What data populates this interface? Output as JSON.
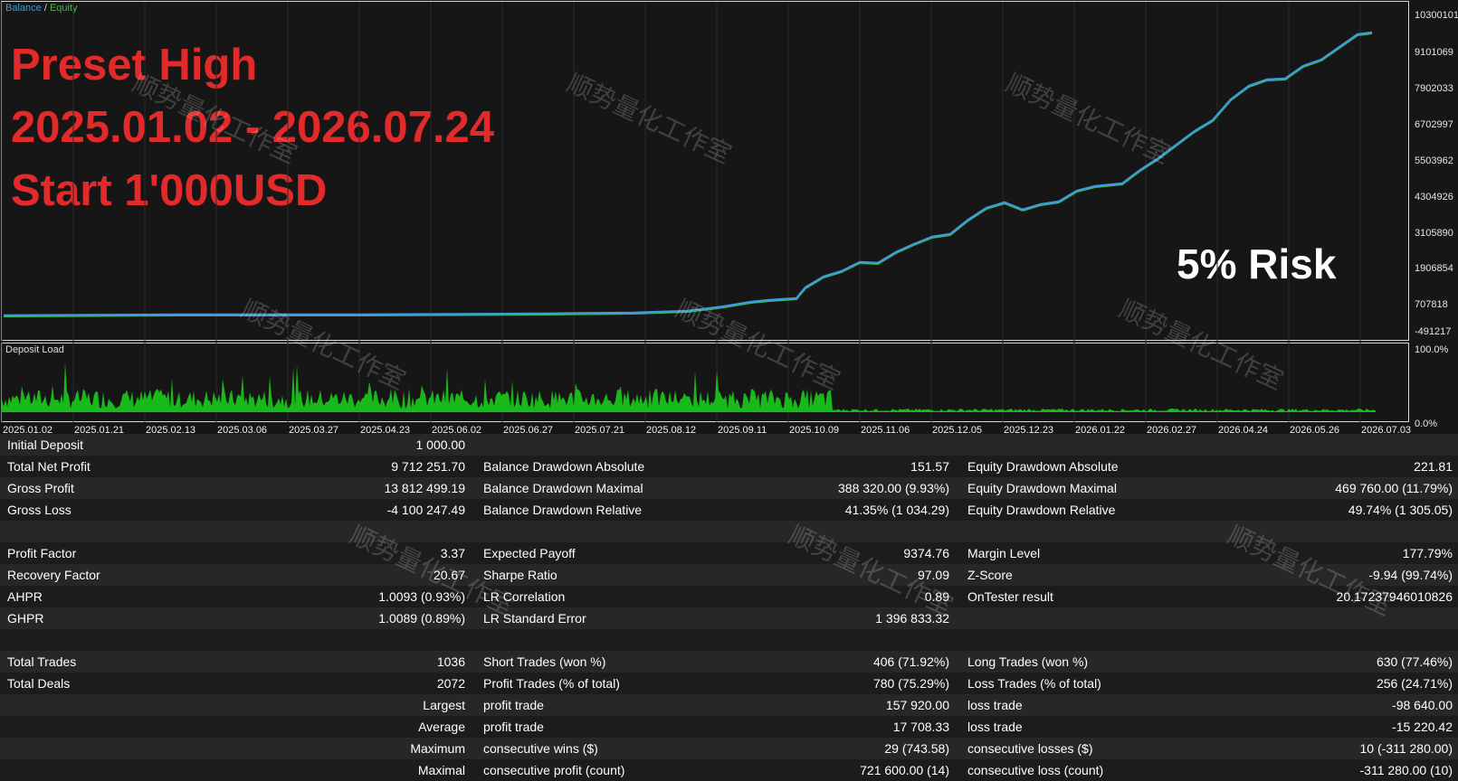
{
  "chart": {
    "title_balance": "Balance",
    "title_separator": "/",
    "title_equity": "Equity",
    "overlay_lines": [
      "Preset High",
      "2025.01.02 - 2026.07.24",
      "Start 1'000USD"
    ],
    "risk_text": "5% Risk",
    "y_axis": [
      "10300101",
      "9101069",
      "7902033",
      "6702997",
      "5503962",
      "4304926",
      "3105890",
      "1906854",
      "707818",
      "-491217"
    ],
    "deposit_title": "Deposit Load",
    "deposit_axis": [
      "100.0%",
      "0.0%"
    ],
    "x_axis": [
      "2025.01.02",
      "2025.01.21",
      "2025.02.13",
      "2025.03.06",
      "2025.03.27",
      "2025.04.23",
      "2025.06.02",
      "2025.06.27",
      "2025.07.21",
      "2025.08.12",
      "2025.09.11",
      "2025.10.09",
      "2025.11.06",
      "2025.12.05",
      "2025.12.23",
      "2026.01.22",
      "2026.02.27",
      "2026.04.24",
      "2026.05.26",
      "2026.07.03"
    ],
    "colors": {
      "balance": "#3d9bd9",
      "equity": "#3ac03a",
      "deposit": "#18b91b",
      "overlay_red": "#e22a2a"
    }
  },
  "watermark": "顺势量化工作室",
  "stats": [
    [
      [
        "Initial Deposit",
        "1 000.00"
      ],
      [
        "",
        ""
      ],
      [
        "",
        ""
      ]
    ],
    [
      [
        "Total Net Profit",
        "9 712 251.70"
      ],
      [
        "Balance Drawdown Absolute",
        "151.57"
      ],
      [
        "Equity Drawdown Absolute",
        "221.81"
      ]
    ],
    [
      [
        "Gross Profit",
        "13 812 499.19"
      ],
      [
        "Balance Drawdown Maximal",
        "388 320.00 (9.93%)"
      ],
      [
        "Equity Drawdown Maximal",
        "469 760.00 (11.79%)"
      ]
    ],
    [
      [
        "Gross Loss",
        "-4 100 247.49"
      ],
      [
        "Balance Drawdown Relative",
        "41.35% (1 034.29)"
      ],
      [
        "Equity Drawdown Relative",
        "49.74% (1 305.05)"
      ]
    ],
    [
      [
        "",
        ""
      ],
      [
        "",
        ""
      ],
      [
        "",
        ""
      ]
    ],
    [
      [
        "Profit Factor",
        "3.37"
      ],
      [
        "Expected Payoff",
        "9374.76"
      ],
      [
        "Margin Level",
        "177.79%"
      ]
    ],
    [
      [
        "Recovery Factor",
        "20.67"
      ],
      [
        "Sharpe Ratio",
        "97.09"
      ],
      [
        "Z-Score",
        "-9.94 (99.74%)"
      ]
    ],
    [
      [
        "AHPR",
        "1.0093 (0.93%)"
      ],
      [
        "LR Correlation",
        "0.89"
      ],
      [
        "OnTester result",
        "20.17237946010826"
      ]
    ],
    [
      [
        "GHPR",
        "1.0089 (0.89%)"
      ],
      [
        "LR Standard Error",
        "1 396 833.32"
      ],
      [
        "",
        ""
      ]
    ],
    [
      [
        "",
        ""
      ],
      [
        "",
        ""
      ],
      [
        "",
        ""
      ]
    ],
    [
      [
        "Total Trades",
        "1036"
      ],
      [
        "Short Trades (won %)",
        "406 (71.92%)"
      ],
      [
        "Long Trades (won %)",
        "630 (77.46%)"
      ]
    ],
    [
      [
        "Total Deals",
        "2072"
      ],
      [
        "Profit Trades (% of total)",
        "780 (75.29%)"
      ],
      [
        "Loss Trades (% of total)",
        "256 (24.71%)"
      ]
    ],
    [
      [
        "",
        "Largest"
      ],
      [
        "profit trade",
        "157 920.00"
      ],
      [
        "loss trade",
        "-98 640.00"
      ]
    ],
    [
      [
        "",
        "Average"
      ],
      [
        "profit trade",
        "17 708.33"
      ],
      [
        "loss trade",
        "-15 220.42"
      ]
    ],
    [
      [
        "",
        "Maximum"
      ],
      [
        "consecutive wins ($)",
        "29 (743.58)"
      ],
      [
        "consecutive losses ($)",
        "10 (-311 280.00)"
      ]
    ],
    [
      [
        "",
        "Maximal"
      ],
      [
        "consecutive profit (count)",
        "721 600.00 (14)"
      ],
      [
        "consecutive loss (count)",
        "-311 280.00 (10)"
      ]
    ]
  ]
}
